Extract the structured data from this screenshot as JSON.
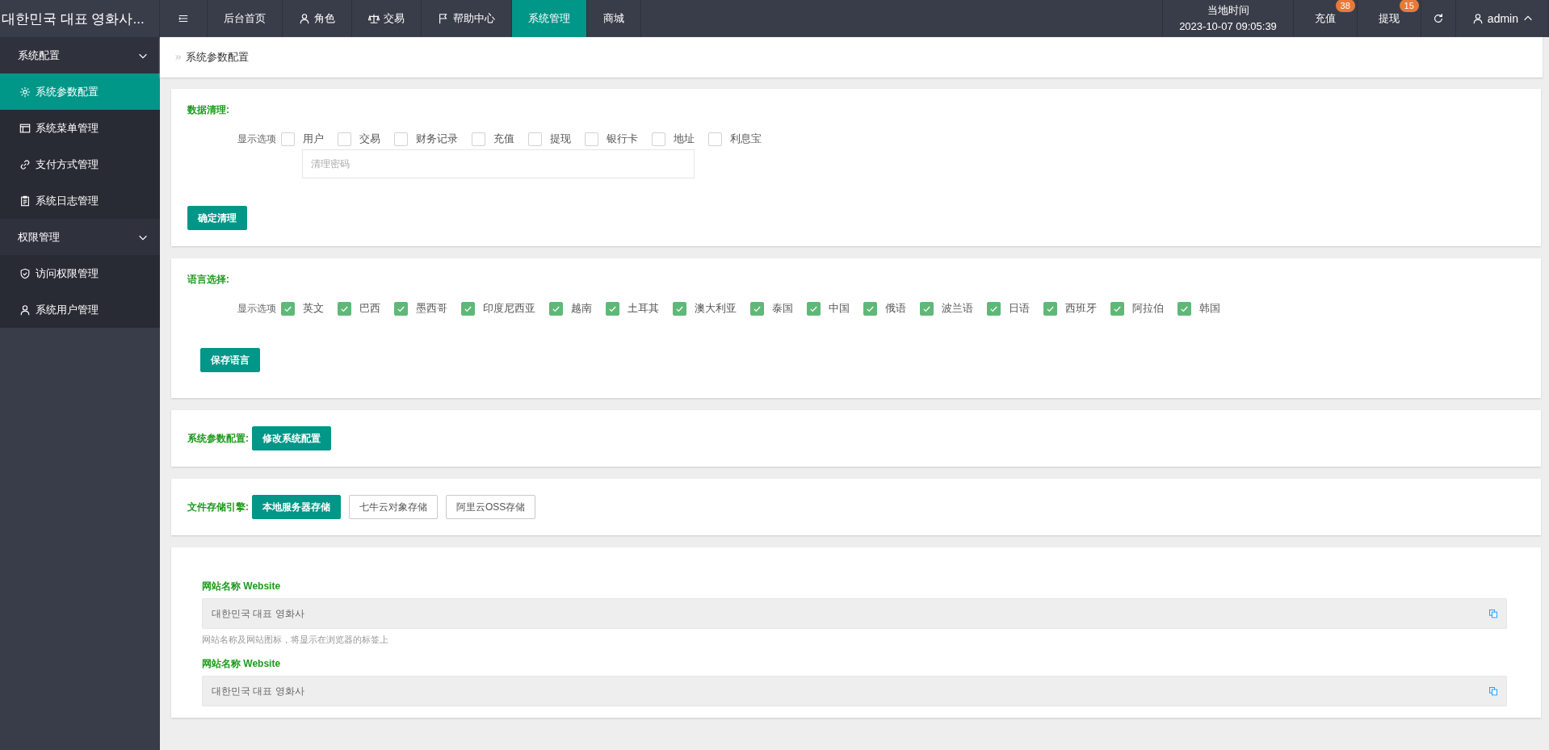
{
  "header": {
    "logo": "대한민국 대표 영화사...",
    "nav": [
      {
        "label": "后台首页",
        "kind": "plain",
        "selected": false
      },
      {
        "label": "角色",
        "kind": "user",
        "selected": false
      },
      {
        "label": "交易",
        "kind": "scale",
        "selected": false
      },
      {
        "label": "帮助中心",
        "kind": "flag",
        "selected": false
      },
      {
        "label": "系统管理",
        "kind": "plain",
        "selected": true
      },
      {
        "label": "商城",
        "kind": "plain",
        "selected": false
      }
    ],
    "clock": {
      "label": "当地时间",
      "time": "2023-10-07 09:05:39"
    },
    "actions": [
      {
        "label": "充值",
        "badge": "38"
      },
      {
        "label": "提现",
        "badge": "15"
      }
    ],
    "user": "admin"
  },
  "sidebar": {
    "groups": [
      {
        "label": "系统配置",
        "expanded": true,
        "items": [
          {
            "label": "系统参数配置",
            "kind": "gear",
            "selected": true
          },
          {
            "label": "系统菜单管理",
            "kind": "window",
            "selected": false
          },
          {
            "label": "支付方式管理",
            "kind": "link",
            "selected": false
          },
          {
            "label": "系统日志管理",
            "kind": "clipboard",
            "selected": false
          }
        ]
      },
      {
        "label": "权限管理",
        "expanded": true,
        "items": [
          {
            "label": "访问权限管理",
            "kind": "shield",
            "selected": false
          },
          {
            "label": "系统用户管理",
            "kind": "user",
            "selected": false
          }
        ]
      }
    ]
  },
  "breadcrumb": "系统参数配置",
  "data_cleanup": {
    "title": "数据清理:",
    "options_label": "显示选项",
    "options": [
      {
        "label": "用户",
        "checked": false
      },
      {
        "label": "交易",
        "checked": false
      },
      {
        "label": "财务记录",
        "checked": false
      },
      {
        "label": "充值",
        "checked": false
      },
      {
        "label": "提现",
        "checked": false
      },
      {
        "label": "银行卡",
        "checked": false
      },
      {
        "label": "地址",
        "checked": false
      },
      {
        "label": "利息宝",
        "checked": false
      }
    ],
    "password": {
      "placeholder": "清理密码"
    },
    "button": "确定清理"
  },
  "language": {
    "title": "语言选择:",
    "options_label": "显示选项",
    "options": [
      {
        "label": "英文",
        "checked": true
      },
      {
        "label": "巴西",
        "checked": true
      },
      {
        "label": "墨西哥",
        "checked": true
      },
      {
        "label": "印度尼西亚",
        "checked": true
      },
      {
        "label": "越南",
        "checked": true
      },
      {
        "label": "土耳其",
        "checked": true
      },
      {
        "label": "澳大利亚",
        "checked": true
      },
      {
        "label": "泰国",
        "checked": true
      },
      {
        "label": "中国",
        "checked": true
      },
      {
        "label": "俄语",
        "checked": true
      },
      {
        "label": "波兰语",
        "checked": true
      },
      {
        "label": "日语",
        "checked": true
      },
      {
        "label": "西班牙",
        "checked": true
      },
      {
        "label": "阿拉伯",
        "checked": true
      },
      {
        "label": "韩国",
        "checked": true
      }
    ],
    "button": "保存语言"
  },
  "system_config": {
    "title": "系统参数配置:",
    "button": "修改系统配置"
  },
  "storage": {
    "title": "文件存储引擎:",
    "options": [
      {
        "label": "本地服务器存储",
        "selected": true
      },
      {
        "label": "七牛云对象存储",
        "selected": false
      },
      {
        "label": "阿里云OSS存储",
        "selected": false
      }
    ]
  },
  "fields": [
    {
      "label": "网站名称 Website",
      "value": "대한민국 대표 영화사",
      "help": "网站名称及网站图标，将显示在浏览器的标签上"
    },
    {
      "label": "网站名称 Website",
      "value": "대한민국 대표 영화사"
    }
  ]
}
